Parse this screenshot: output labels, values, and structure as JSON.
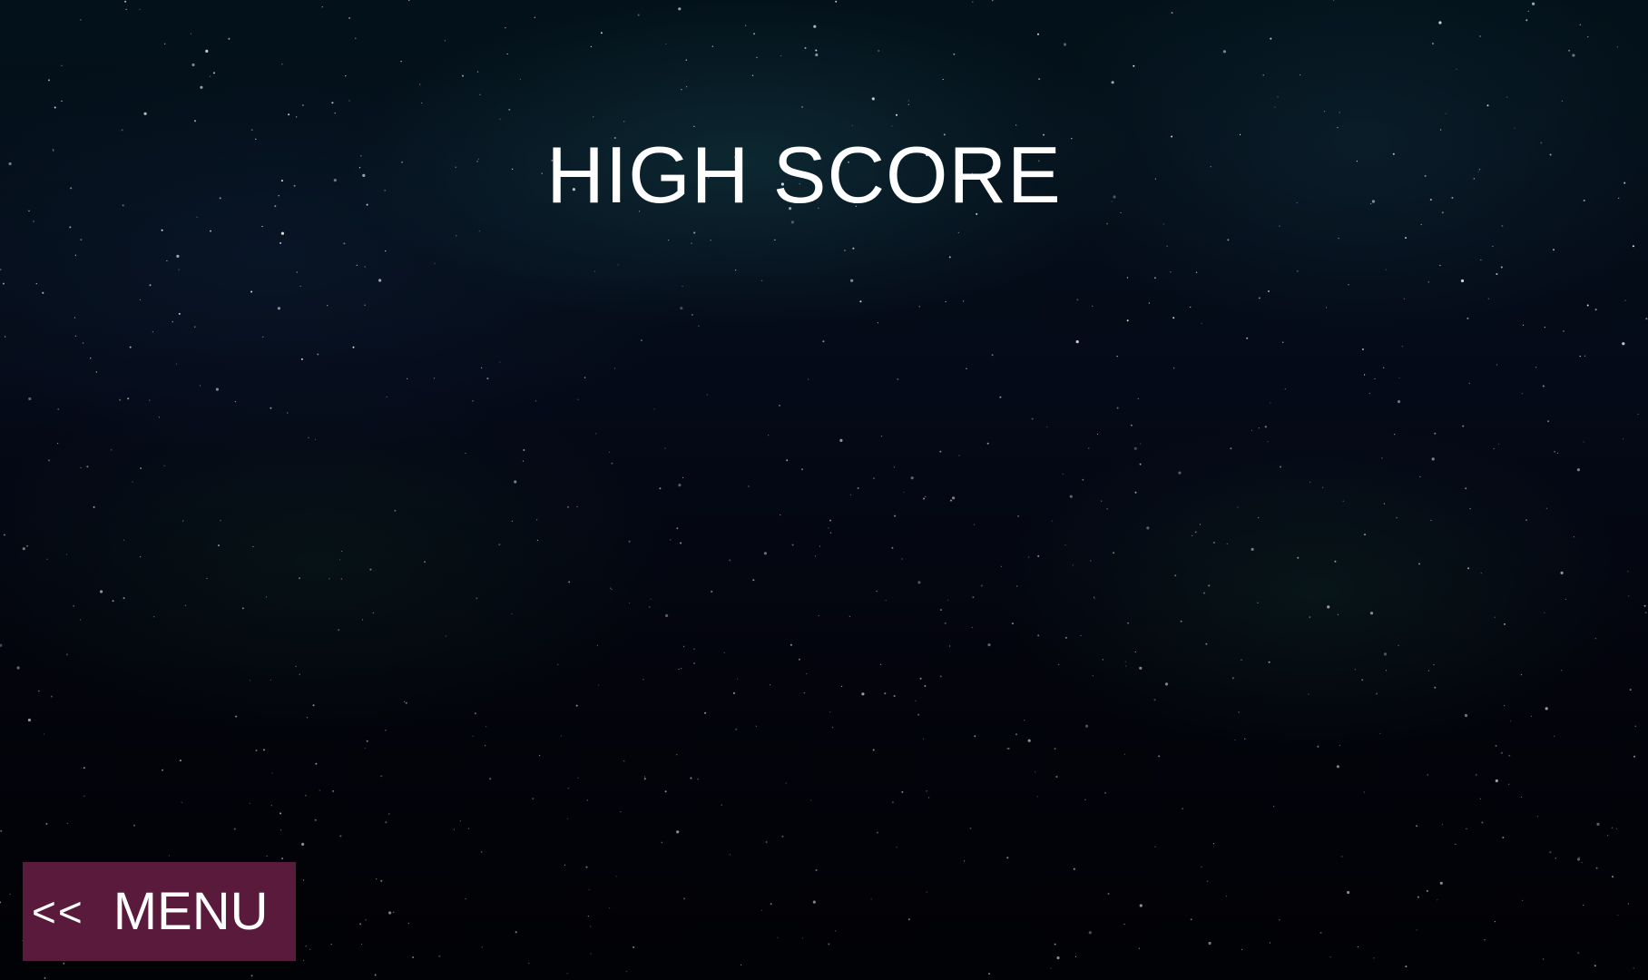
{
  "screen": {
    "title": "HIGH SCORE",
    "background": "starfield-space",
    "colors": {
      "title": "#ffffff",
      "menu_button_bg": "#5a1a3c",
      "menu_button_text": "#ffffff"
    }
  },
  "menu_button": {
    "icon": "double-left-arrow-icon",
    "arrow_text": "<<",
    "label": "MENU"
  }
}
